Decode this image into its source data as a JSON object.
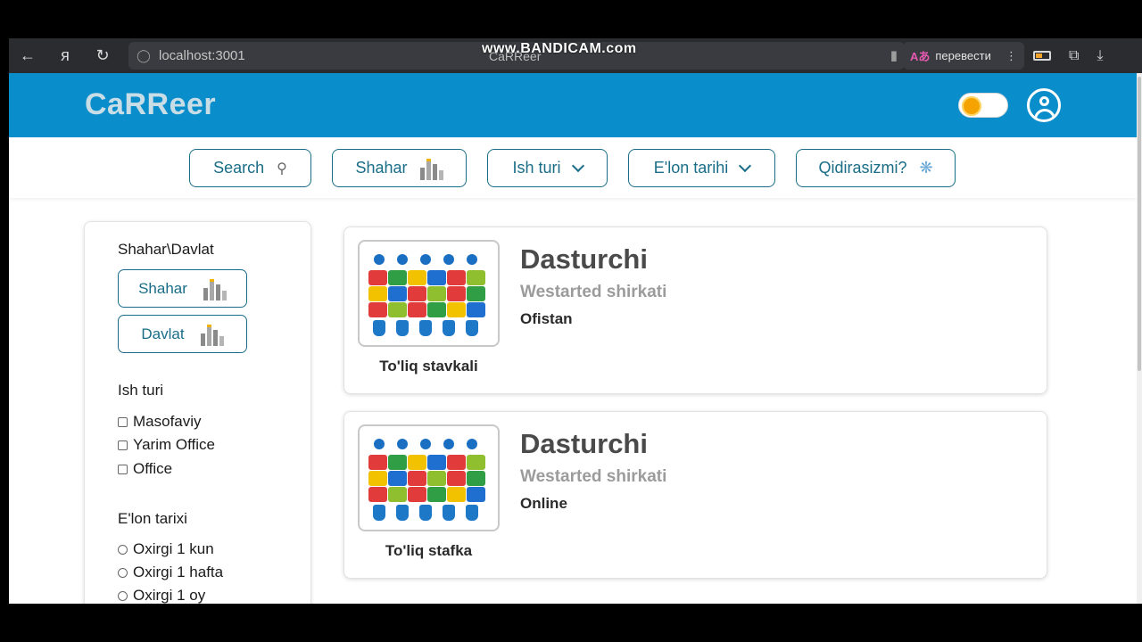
{
  "browser": {
    "url": "localhost:3001",
    "tab_title": "CaRReer",
    "translate_label": "перевести",
    "watermark": "www.BANDICAM.com"
  },
  "header": {
    "logo": "CaRReer"
  },
  "filters": [
    {
      "label": "Search",
      "icon": "search-icon"
    },
    {
      "label": "Shahar",
      "icon": "buildings-icon"
    },
    {
      "label": "Ish turi",
      "icon": "chevron-down-icon"
    },
    {
      "label": "E'lon tarihi",
      "icon": "chevron-down-icon"
    },
    {
      "label": "Qidirasizmi?",
      "icon": "spinner-icon"
    }
  ],
  "sidebar": {
    "location_title": "Shahar\\Davlat",
    "city_button": "Shahar",
    "country_button": "Davlat",
    "work_type_title": "Ish turi",
    "work_types": [
      "Masofaviy",
      "Yarim Office",
      "Office"
    ],
    "post_date_title": "E'lon tarixi",
    "post_dates": [
      "Oxirgi 1 kun",
      "Oxirgi 1 hafta",
      "Oxirgi 1 oy"
    ]
  },
  "jobs": [
    {
      "title": "Dasturchi",
      "company": "Westarted shirkati",
      "location": "Ofistan",
      "type": "To'liq stavkali",
      "image": "teamwork-puzzle"
    },
    {
      "title": "Dasturchi",
      "company": "Westarted shirkati",
      "location": "Online",
      "type": "To'liq stafka",
      "image": "teamwork-puzzle"
    }
  ],
  "colors": {
    "header_bg": "#0a8dcb",
    "accent": "#1a6d87",
    "toggle_knob": "#f5a300"
  }
}
